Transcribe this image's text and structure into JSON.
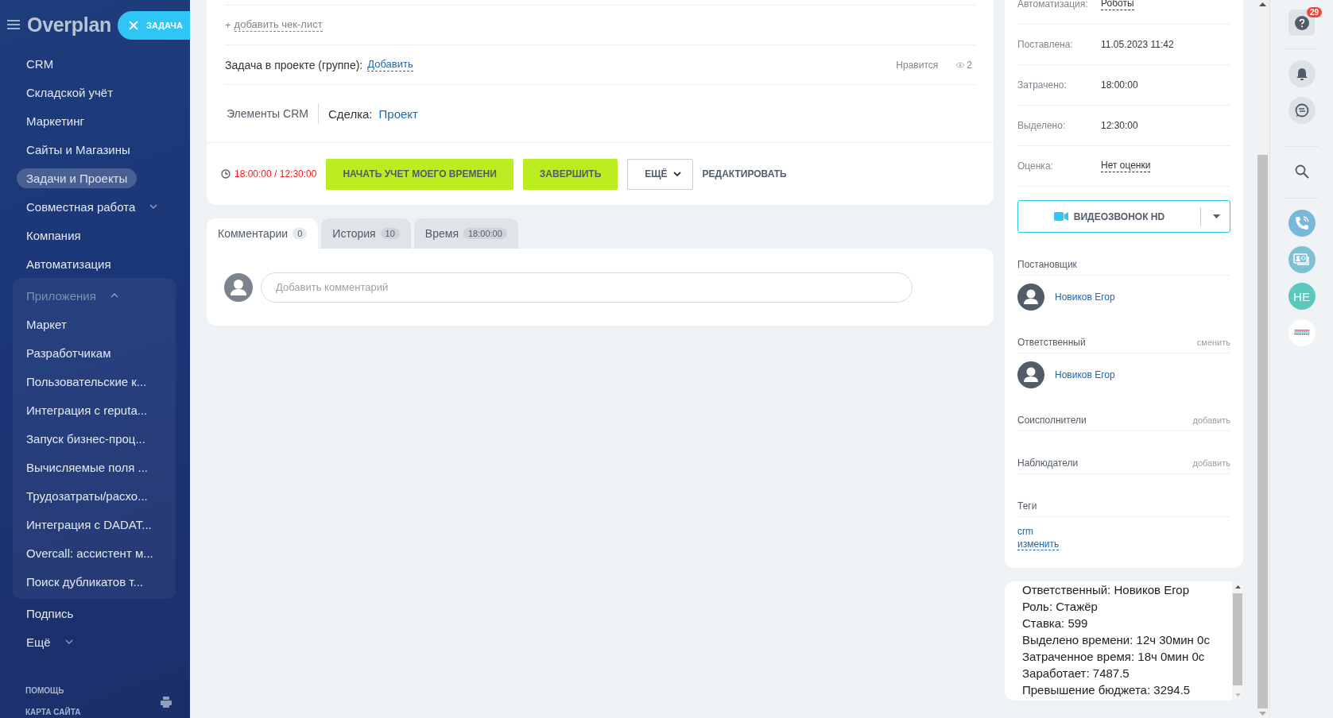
{
  "sidebar": {
    "logo": "Overplan",
    "task_button": "ЗАДАЧА",
    "items": [
      {
        "label": "CRM",
        "selected": false,
        "expandable": false
      },
      {
        "label": "Складской учёт",
        "selected": false,
        "expandable": false
      },
      {
        "label": "Маркетинг",
        "selected": false,
        "expandable": false
      },
      {
        "label": "Сайты и Магазины",
        "selected": false,
        "expandable": false
      },
      {
        "label": "Задачи и Проекты",
        "selected": true,
        "expandable": false
      },
      {
        "label": "Совместная работа",
        "selected": false,
        "expandable": true
      },
      {
        "label": "Компания",
        "selected": false,
        "expandable": false
      },
      {
        "label": "Автоматизация",
        "selected": false,
        "expandable": false
      }
    ],
    "apps": {
      "label": "Приложения",
      "expanded": true,
      "items": [
        {
          "label": "Маркет"
        },
        {
          "label": "Разработчикам"
        },
        {
          "label": "Пользовательские к..."
        },
        {
          "label": "Интеграция с reputa..."
        },
        {
          "label": "Запуск бизнес-проц..."
        },
        {
          "label": "Вычисляемые поля ..."
        },
        {
          "label": "Трудозатраты/расхо..."
        },
        {
          "label": "Интеграция с DADAT..."
        },
        {
          "label": "Overcall: ассистент м..."
        },
        {
          "label": "Поиск дубликатов т..."
        }
      ]
    },
    "bottom_items": [
      {
        "label": "Подпись",
        "expandable": false
      },
      {
        "label": "Ещё",
        "expandable": true
      }
    ],
    "footer_links": [
      "ПОМОЩЬ",
      "КАРТА САЙТА"
    ]
  },
  "task": {
    "checklist": {
      "prefix": "+",
      "link": "добавить чек-лист"
    },
    "project": {
      "label": "Задача в проекте (группе):",
      "link": "Добавить",
      "likes": "Нравится",
      "views": "2"
    },
    "crm": {
      "label": "Элементы CRM",
      "deal_label": "Сделка:",
      "deal_link": "Проект"
    },
    "timer": "18:00:00 / 12:30:00",
    "buttons": [
      {
        "label": "НАЧАТЬ УЧЕТ МОЕГО ВРЕМЕНИ",
        "kind": "primary"
      },
      {
        "label": "ЗАВЕРШИТЬ",
        "kind": "primary"
      },
      {
        "label": "ЕЩЁ",
        "kind": "dropdown"
      },
      {
        "label": "РЕДАКТИРОВАТЬ",
        "kind": "text"
      }
    ]
  },
  "tabs": [
    {
      "label": "Комментарии",
      "count": "0",
      "selected": true
    },
    {
      "label": "История",
      "count": "10",
      "selected": false
    },
    {
      "label": "Время",
      "count": "18:00:00",
      "selected": false
    }
  ],
  "comment": {
    "placeholder": "Добавить комментарий"
  },
  "details": {
    "fields": [
      {
        "label": "Автоматизация:",
        "value": "Роботы",
        "kind": "link"
      },
      {
        "label": "Поставлена:",
        "value": "11.05.2023 11:42",
        "kind": "plain"
      },
      {
        "label": "Затрачено:",
        "value": "18:00:00",
        "kind": "plain"
      },
      {
        "label": "Выделено:",
        "value": "12:30:00",
        "kind": "plain"
      },
      {
        "label": "Оценка:",
        "value": "Нет оценки",
        "kind": "link"
      }
    ],
    "video_button": "ВИДЕОЗВОНОК HD",
    "roles": [
      {
        "title": "Постановщик",
        "people": [
          "Новиков Егор"
        ]
      },
      {
        "title": "Ответственный",
        "action": "сменить",
        "people": [
          "Новиков Егор"
        ]
      },
      {
        "title": "Соисполнители",
        "action": "добавить"
      },
      {
        "title": "Наблюдатели",
        "action": "добавить"
      }
    ],
    "tags": {
      "title": "Теги",
      "items": [
        "crm"
      ],
      "action": "изменить"
    }
  },
  "info_lines": [
    "Ответственный: Новиков Егор",
    "Роль: Стажёр",
    "Ставка: 599",
    "Выделено времени: 12ч 30мин 0с",
    "Затраченное время: 18ч 0мин 0с",
    "Заработает: 7487.5",
    "Превышение бюджета: 3294.5"
  ],
  "rail": {
    "help_badge": "29",
    "avatar_initials": "НЕ"
  }
}
